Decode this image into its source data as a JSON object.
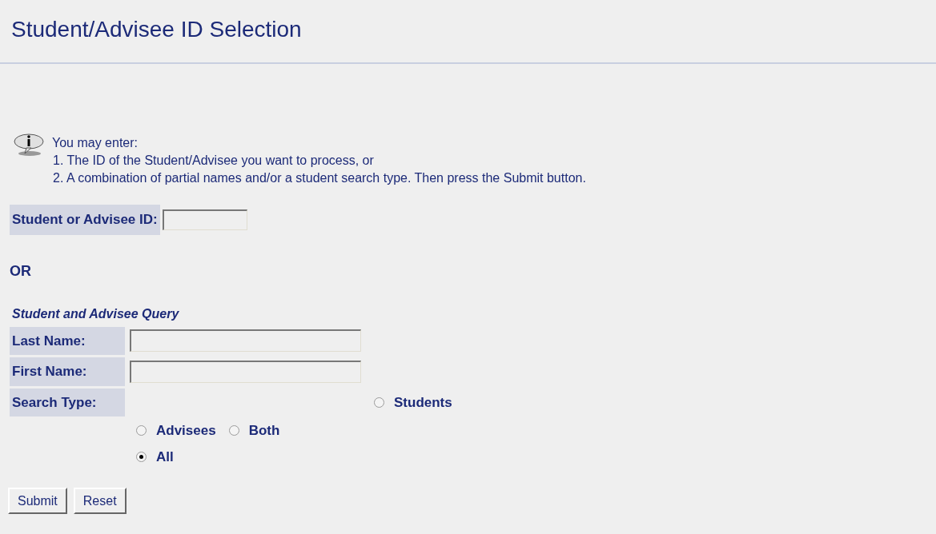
{
  "page_title": "Student/Advisee ID Selection",
  "info": {
    "intro": "You may enter:",
    "steps": [
      "1. The ID of the Student/Advisee you want to process, or",
      "2. A combination of partial names and/or a student search type. Then press the Submit button."
    ]
  },
  "id_field": {
    "label": "Student or Advisee ID:"
  },
  "or_label": "OR",
  "query": {
    "heading": "Student and Advisee Query",
    "fields": [
      {
        "label": "Last Name:"
      },
      {
        "label": "First Name:"
      }
    ],
    "search_type": {
      "label": "Search Type:",
      "options": [
        {
          "label": "Students",
          "selected": false
        },
        {
          "label": "Advisees",
          "selected": false
        },
        {
          "label": "Both",
          "selected": false
        },
        {
          "label": "All",
          "selected": true
        }
      ]
    }
  },
  "buttons": [
    "Submit",
    "Reset"
  ]
}
